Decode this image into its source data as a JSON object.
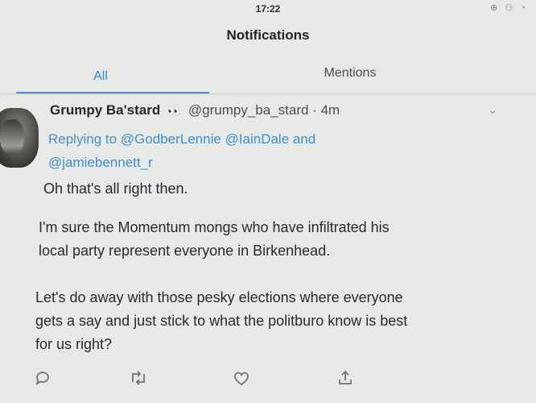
{
  "status_bar": {
    "time": "17:22",
    "icons": "⊕ ⚇ ◔"
  },
  "header": {
    "title": "Notifications"
  },
  "tabs": [
    {
      "label": "All",
      "active": true
    },
    {
      "label": "Mentions",
      "active": false
    }
  ],
  "tweet": {
    "display_name": "Grumpy Ba'stard",
    "emoji": "👀",
    "handle_time": "@grumpy_ba_stard · 4m",
    "replying_prefix": "Replying to",
    "reply_users_line1": "@GodberLennie @IainDale and",
    "reply_users_line2": "@jamiebennett_r",
    "paragraph_1": "Oh that's all right then.",
    "paragraph_2_line1": "I'm sure the Momentum mongs who have infiltrated his",
    "paragraph_2_line2": "local party represent everyone in Birkenhead.",
    "paragraph_3_line1": "Let's do away with those pesky elections where everyone",
    "paragraph_3_line2": "gets a say and just stick to what the politburo know is best",
    "paragraph_3_line3": "for us right?"
  },
  "actions": [
    "reply-icon",
    "retweet-icon",
    "like-icon",
    "share-icon"
  ],
  "colors": {
    "accent": "#3e8ecb",
    "background": "#e7e9e6",
    "text": "#272b2e"
  }
}
